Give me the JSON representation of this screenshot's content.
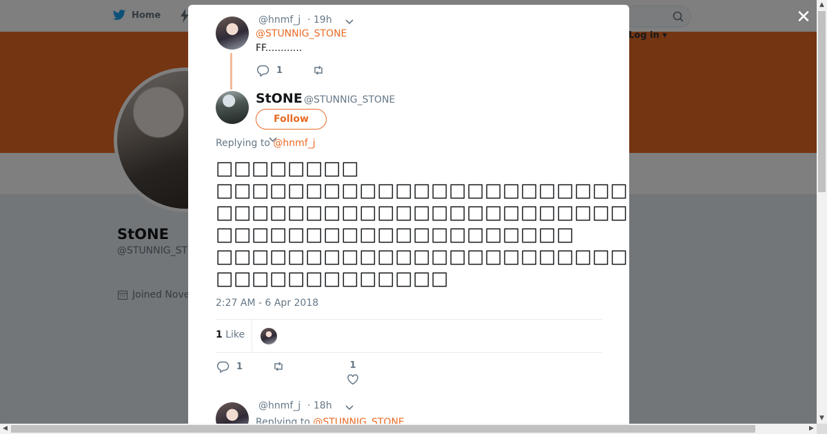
{
  "nav": {
    "home_label": "Home",
    "login_label": "Log in"
  },
  "profile": {
    "name": "StONE",
    "handle": "@STUNNIG_STONE",
    "joined": "Joined Nove"
  },
  "modal": {
    "parent_tweet": {
      "handle": "@hnmf_j",
      "time": "· 19h",
      "mention": "@STUNNIG_STONE",
      "text": "FF............",
      "reply_count": "1"
    },
    "main_tweet": {
      "name": "StONE",
      "handle": "@STUNNIG_STONE",
      "follow_label": "Follow",
      "replying_prefix": "Replying to",
      "replying_to": "@hnmf_j",
      "body": "□□□□□□□□\n□□□□□□□□□□□□□□□□□□□□□□□□\n□□□□□□□□□□□□□□□□□□□□□□□□□□\n□□□□□□□□□□□□□□□□□□□□\n□□□□□□□□□□□□□□□□□□□□□□□□□□□\n□□□□□□□□□□□□□",
      "timestamp": "2:27 AM - 6 Apr 2018",
      "like_count": "1",
      "like_label": "Like",
      "reply_count": "1",
      "heart_count": "1"
    },
    "next_tweet": {
      "handle": "@hnmf_j",
      "time": "· 18h",
      "replying_prefix": "Replying to",
      "replying_to": "@STUNNIG_STONE"
    }
  },
  "colors": {
    "accent": "#e86a24",
    "banner": "#e86a24",
    "twitter_blue": "#1da1f2"
  }
}
